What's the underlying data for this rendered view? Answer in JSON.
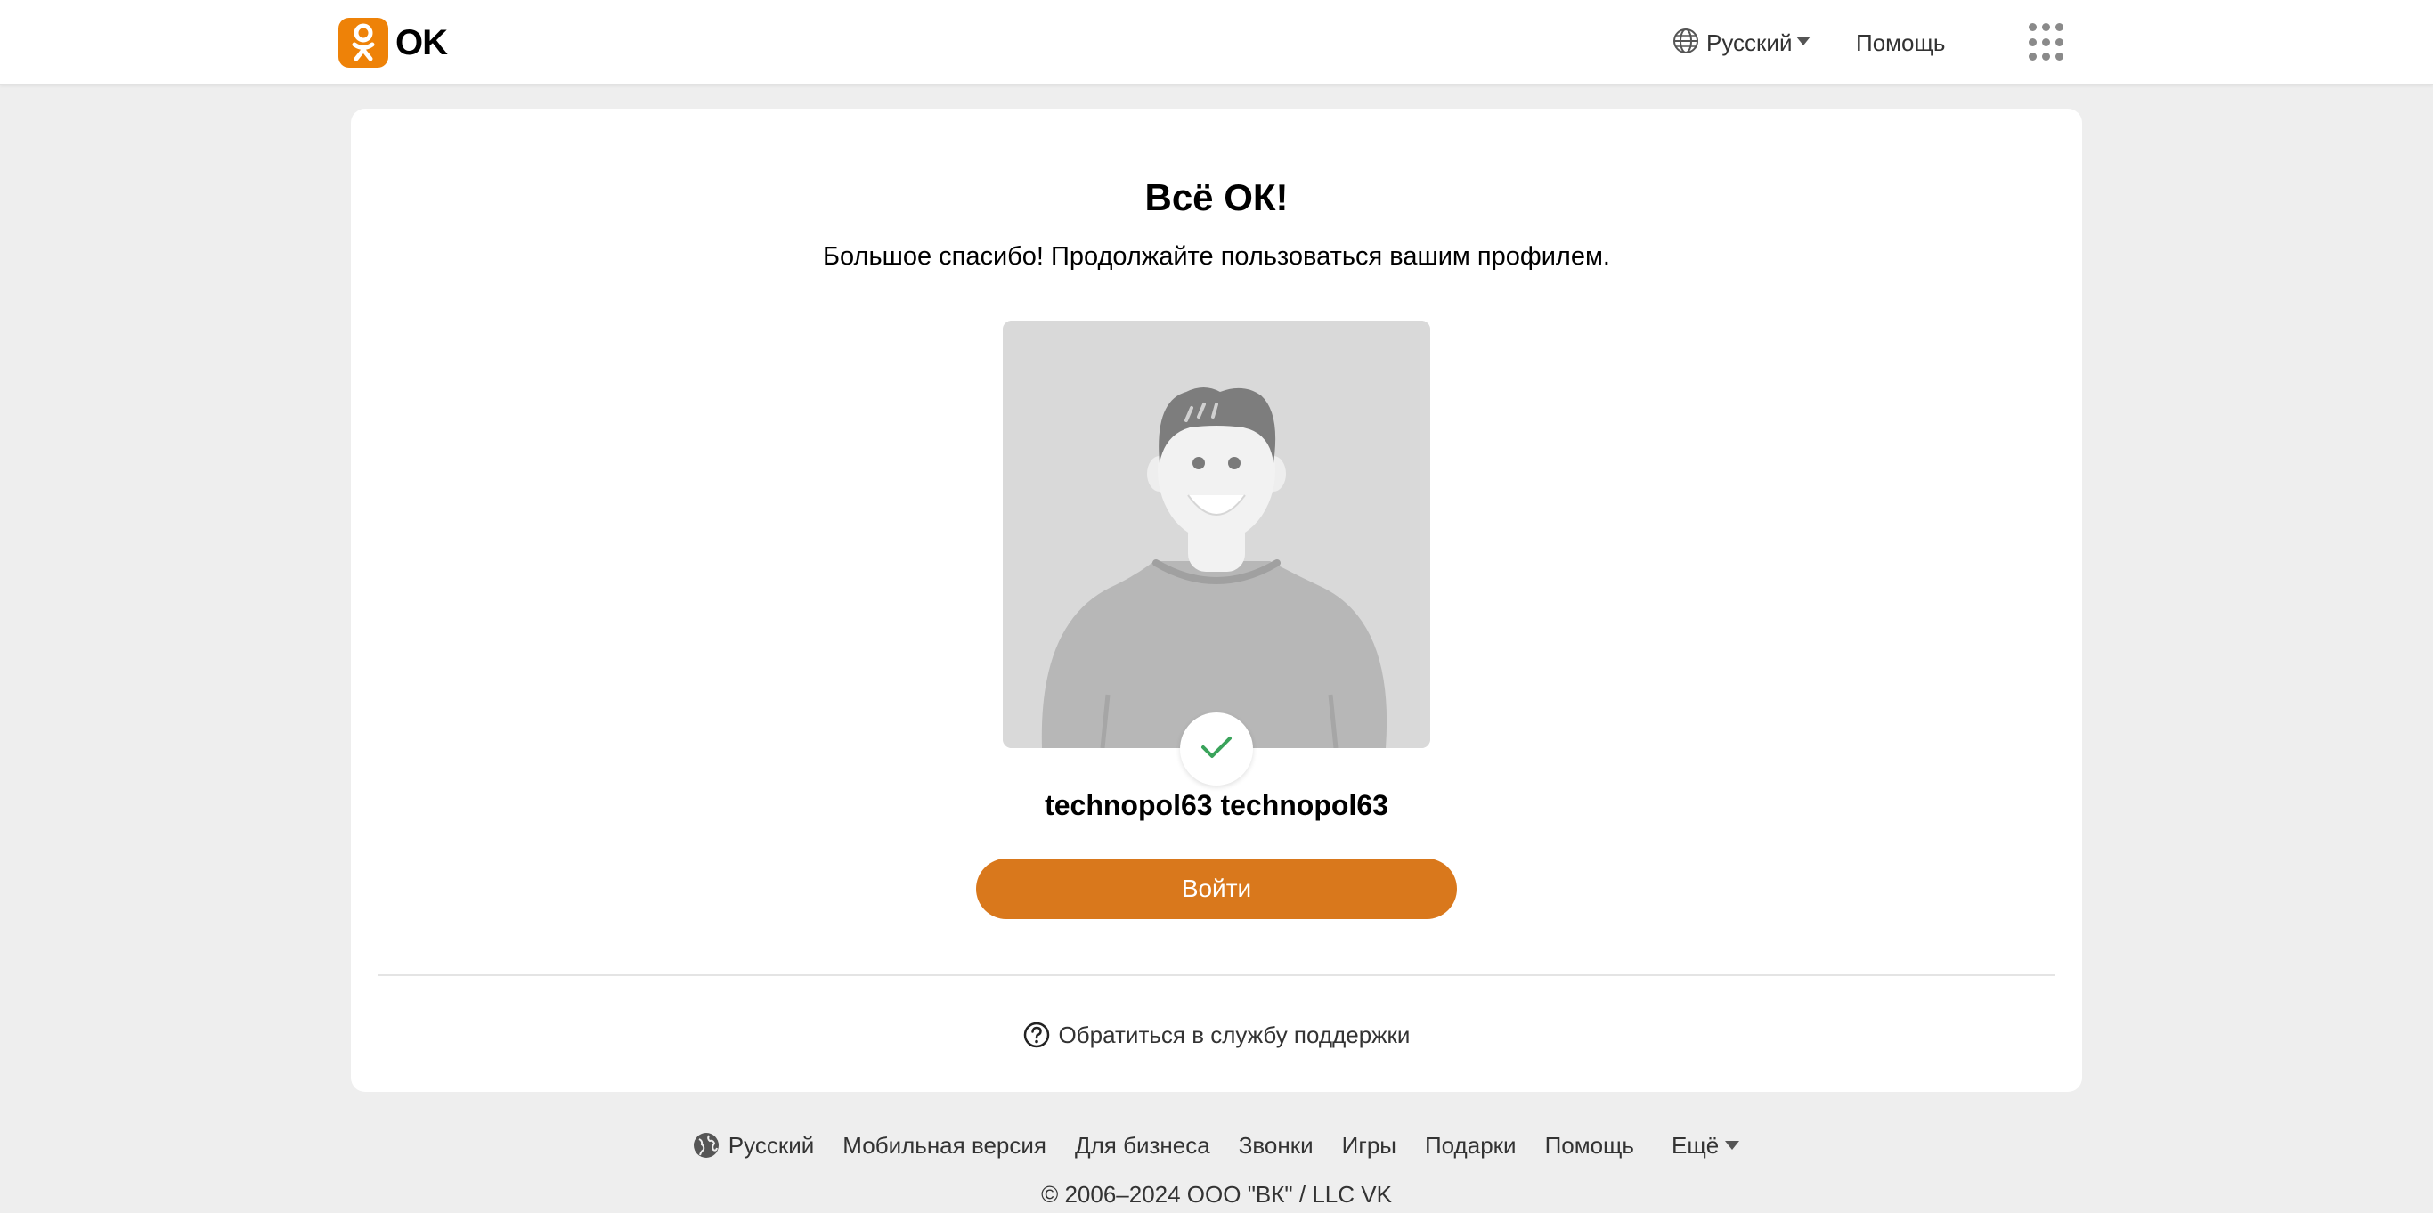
{
  "header": {
    "logo_text": "OK",
    "language_label": "Русский",
    "help_label": "Помощь"
  },
  "main": {
    "title": "Всё ОК!",
    "subtitle": "Большое спасибо! Продолжайте пользоваться вашим профилем.",
    "username": "technopol63 technopol63",
    "login_button": "Войти",
    "support_link": "Обратиться в службу поддержки"
  },
  "footer": {
    "links": [
      "Русский",
      "Мобильная версия",
      "Для бизнеса",
      "Звонки",
      "Игры",
      "Подарки",
      "Помощь",
      "Ещё"
    ],
    "copyright": "© 2006–2024 ООО \"ВК\" / LLC VK"
  },
  "colors": {
    "brand": "#ee8208",
    "button": "#d9781c",
    "check": "#3aa35b",
    "background": "#eeeeee"
  },
  "icons": {
    "language": "globe-icon",
    "apps": "apps-grid-icon",
    "verified": "check-icon",
    "support": "question-circle-icon"
  }
}
